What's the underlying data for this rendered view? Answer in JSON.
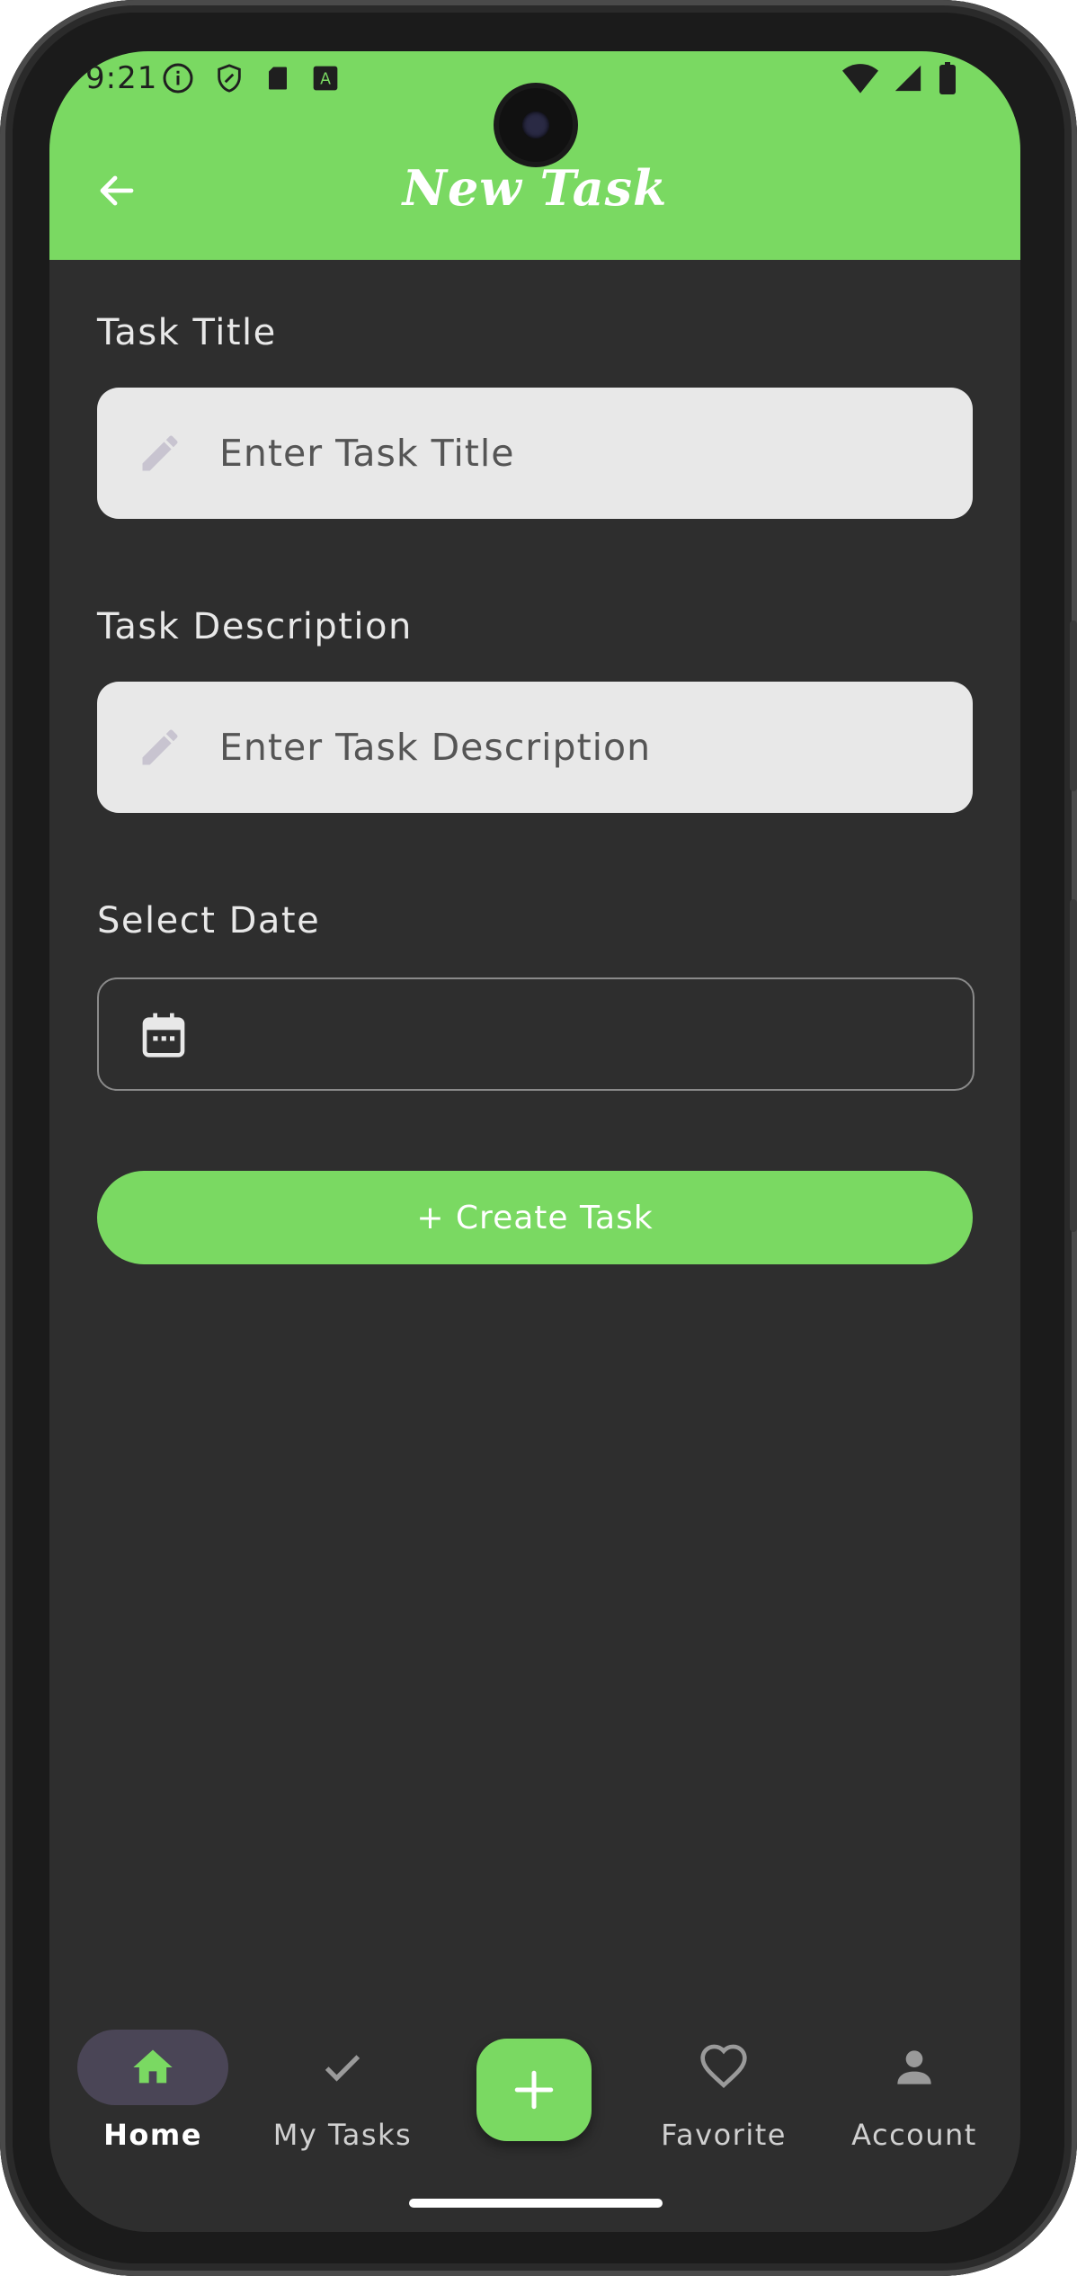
{
  "status_bar": {
    "time": "9:21",
    "left_icons": [
      "info-icon",
      "shield-icon",
      "sd-card-icon",
      "keyboard-a-icon"
    ],
    "right_icons": [
      "wifi-icon",
      "signal-icon",
      "battery-icon"
    ]
  },
  "header": {
    "title": "New Task",
    "back_icon": "arrow-left-icon"
  },
  "form": {
    "title_label": "Task Title",
    "title_placeholder": "Enter Task Title",
    "title_value": "",
    "description_label": "Task Description",
    "description_placeholder": "Enter Task Description",
    "description_value": "",
    "date_label": "Select Date",
    "date_value": "",
    "create_button": "+ Create Task"
  },
  "bottom_nav": {
    "items": [
      {
        "label": "Home",
        "icon": "home-icon",
        "active": true
      },
      {
        "label": "My Tasks",
        "icon": "check-icon",
        "active": false
      },
      {
        "label": "Favorite",
        "icon": "heart-icon",
        "active": false
      },
      {
        "label": "Account",
        "icon": "person-icon",
        "active": false
      }
    ],
    "fab_icon": "plus-icon"
  },
  "colors": {
    "accent": "#7ad962",
    "background": "#2e2e2e",
    "input_bg": "#e8e8e8",
    "active_pill": "#4a4556"
  }
}
